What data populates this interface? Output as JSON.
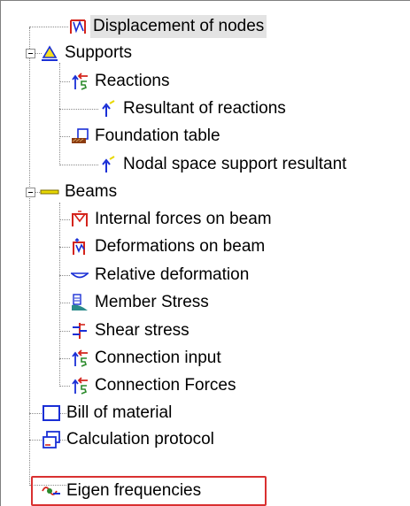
{
  "tree": {
    "items": [
      {
        "label": "Displacement of nodes",
        "icon": "node-displacement-icon"
      },
      {
        "label": "Supports",
        "icon": "support-icon"
      },
      {
        "label": "Reactions",
        "icon": "reactions-icon"
      },
      {
        "label": "Resultant of reactions",
        "icon": "resultant-arrow-icon"
      },
      {
        "label": "Foundation table",
        "icon": "foundation-table-icon"
      },
      {
        "label": "Nodal space support resultant",
        "icon": "resultant-arrow-icon"
      },
      {
        "label": "Beams",
        "icon": "beam-icon"
      },
      {
        "label": "Internal forces on beam",
        "icon": "internal-forces-icon"
      },
      {
        "label": "Deformations on beam",
        "icon": "beam-deformation-icon"
      },
      {
        "label": "Relative deformation",
        "icon": "relative-deformation-icon"
      },
      {
        "label": "Member Stress",
        "icon": "member-stress-icon"
      },
      {
        "label": "Shear stress",
        "icon": "shear-stress-icon"
      },
      {
        "label": "Connection input",
        "icon": "connection-icon"
      },
      {
        "label": "Connection Forces",
        "icon": "connection-icon"
      },
      {
        "label": "Bill of material",
        "icon": "bill-of-material-icon"
      },
      {
        "label": "Calculation protocol",
        "icon": "calculation-protocol-icon"
      },
      {
        "label": "Eigen frequencies",
        "icon": "eigen-frequency-icon"
      }
    ]
  },
  "colors": {
    "selection": "#e3e3e3",
    "highlight_border": "#d93030",
    "icon_red": "#d4241c",
    "icon_blue": "#1a2fd6",
    "icon_yellow": "#e8d800",
    "icon_green": "#2a8a2a"
  }
}
